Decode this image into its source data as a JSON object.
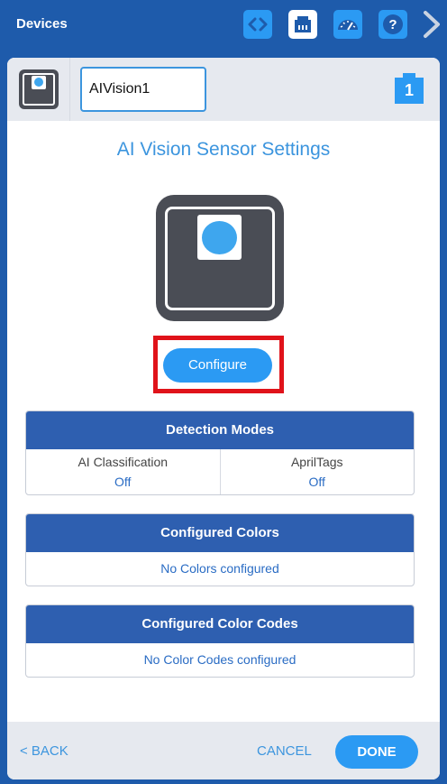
{
  "topbar": {
    "title": "Devices",
    "buttons": [
      "code-icon",
      "device-port-icon",
      "dashboard-gauge-icon",
      "help-icon"
    ],
    "active_button": "device-port-icon",
    "accent": "#2b9af3"
  },
  "device": {
    "name": "AIVision1",
    "port": "1"
  },
  "page": {
    "title": "AI Vision Sensor Settings",
    "configure_label": "Configure"
  },
  "detection_modes": {
    "header": "Detection Modes",
    "modes": [
      {
        "label": "AI Classification",
        "value": "Off"
      },
      {
        "label": "AprilTags",
        "value": "Off"
      }
    ]
  },
  "configured_colors": {
    "header": "Configured Colors",
    "empty_text": "No Colors configured"
  },
  "configured_color_codes": {
    "header": "Configured Color Codes",
    "empty_text": "No Color Codes configured"
  },
  "footer": {
    "back_label": "< BACK",
    "cancel_label": "CANCEL",
    "done_label": "DONE"
  }
}
